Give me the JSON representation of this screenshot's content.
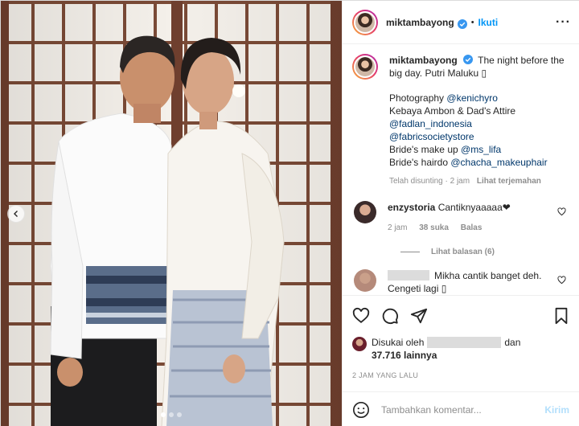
{
  "post": {
    "username": "miktambayong",
    "follow_label": "Ikuti",
    "separator": "•",
    "more_label": "···"
  },
  "caption": {
    "username": "miktambayong",
    "text_first": "The night before the big day. Putri Maluku",
    "emoji_placeholder": "▯",
    "credit_photo_label": "Photography",
    "credit_photo_mention": "@kenichyro",
    "credit_attire": "Kebaya Ambon & Dad's Attire",
    "mention_fadlan": "@fadlan_indonesia",
    "mention_fabric": "@fabricsocietystore",
    "makeup_label": "Bride's make up",
    "makeup_mention": "@ms_lifa",
    "hairdo_label": "Bride's hairdo",
    "hairdo_mention": "@chacha_makeuphair",
    "edited_label": "Telah disunting",
    "edited_time": "2 jam",
    "translate_label": "Lihat terjemahan"
  },
  "comments": [
    {
      "username": "enzystoria",
      "text": "Cantiknyaaaaa❤",
      "time": "2 jam",
      "likes": "38 suka",
      "reply_label": "Balas",
      "view_replies": "Lihat balasan (6)"
    },
    {
      "text": "Mikha cantik banget deh. Cengeti lagi ▯"
    }
  ],
  "likes": {
    "prefix": "Disukai oleh",
    "and_label": "dan",
    "count": "37.716",
    "others_label": "lainnya"
  },
  "timestamp": "2 JAM YANG LALU",
  "add_comment": {
    "placeholder": "Tambahkan komentar...",
    "post_label": "Kirim"
  },
  "carousel": {
    "slides": 3,
    "active_index": 0
  },
  "colors": {
    "accent": "#0095f6",
    "verified": "#3897f0",
    "muted": "#8e8e8e",
    "post_disabled": "#b2dffc"
  }
}
